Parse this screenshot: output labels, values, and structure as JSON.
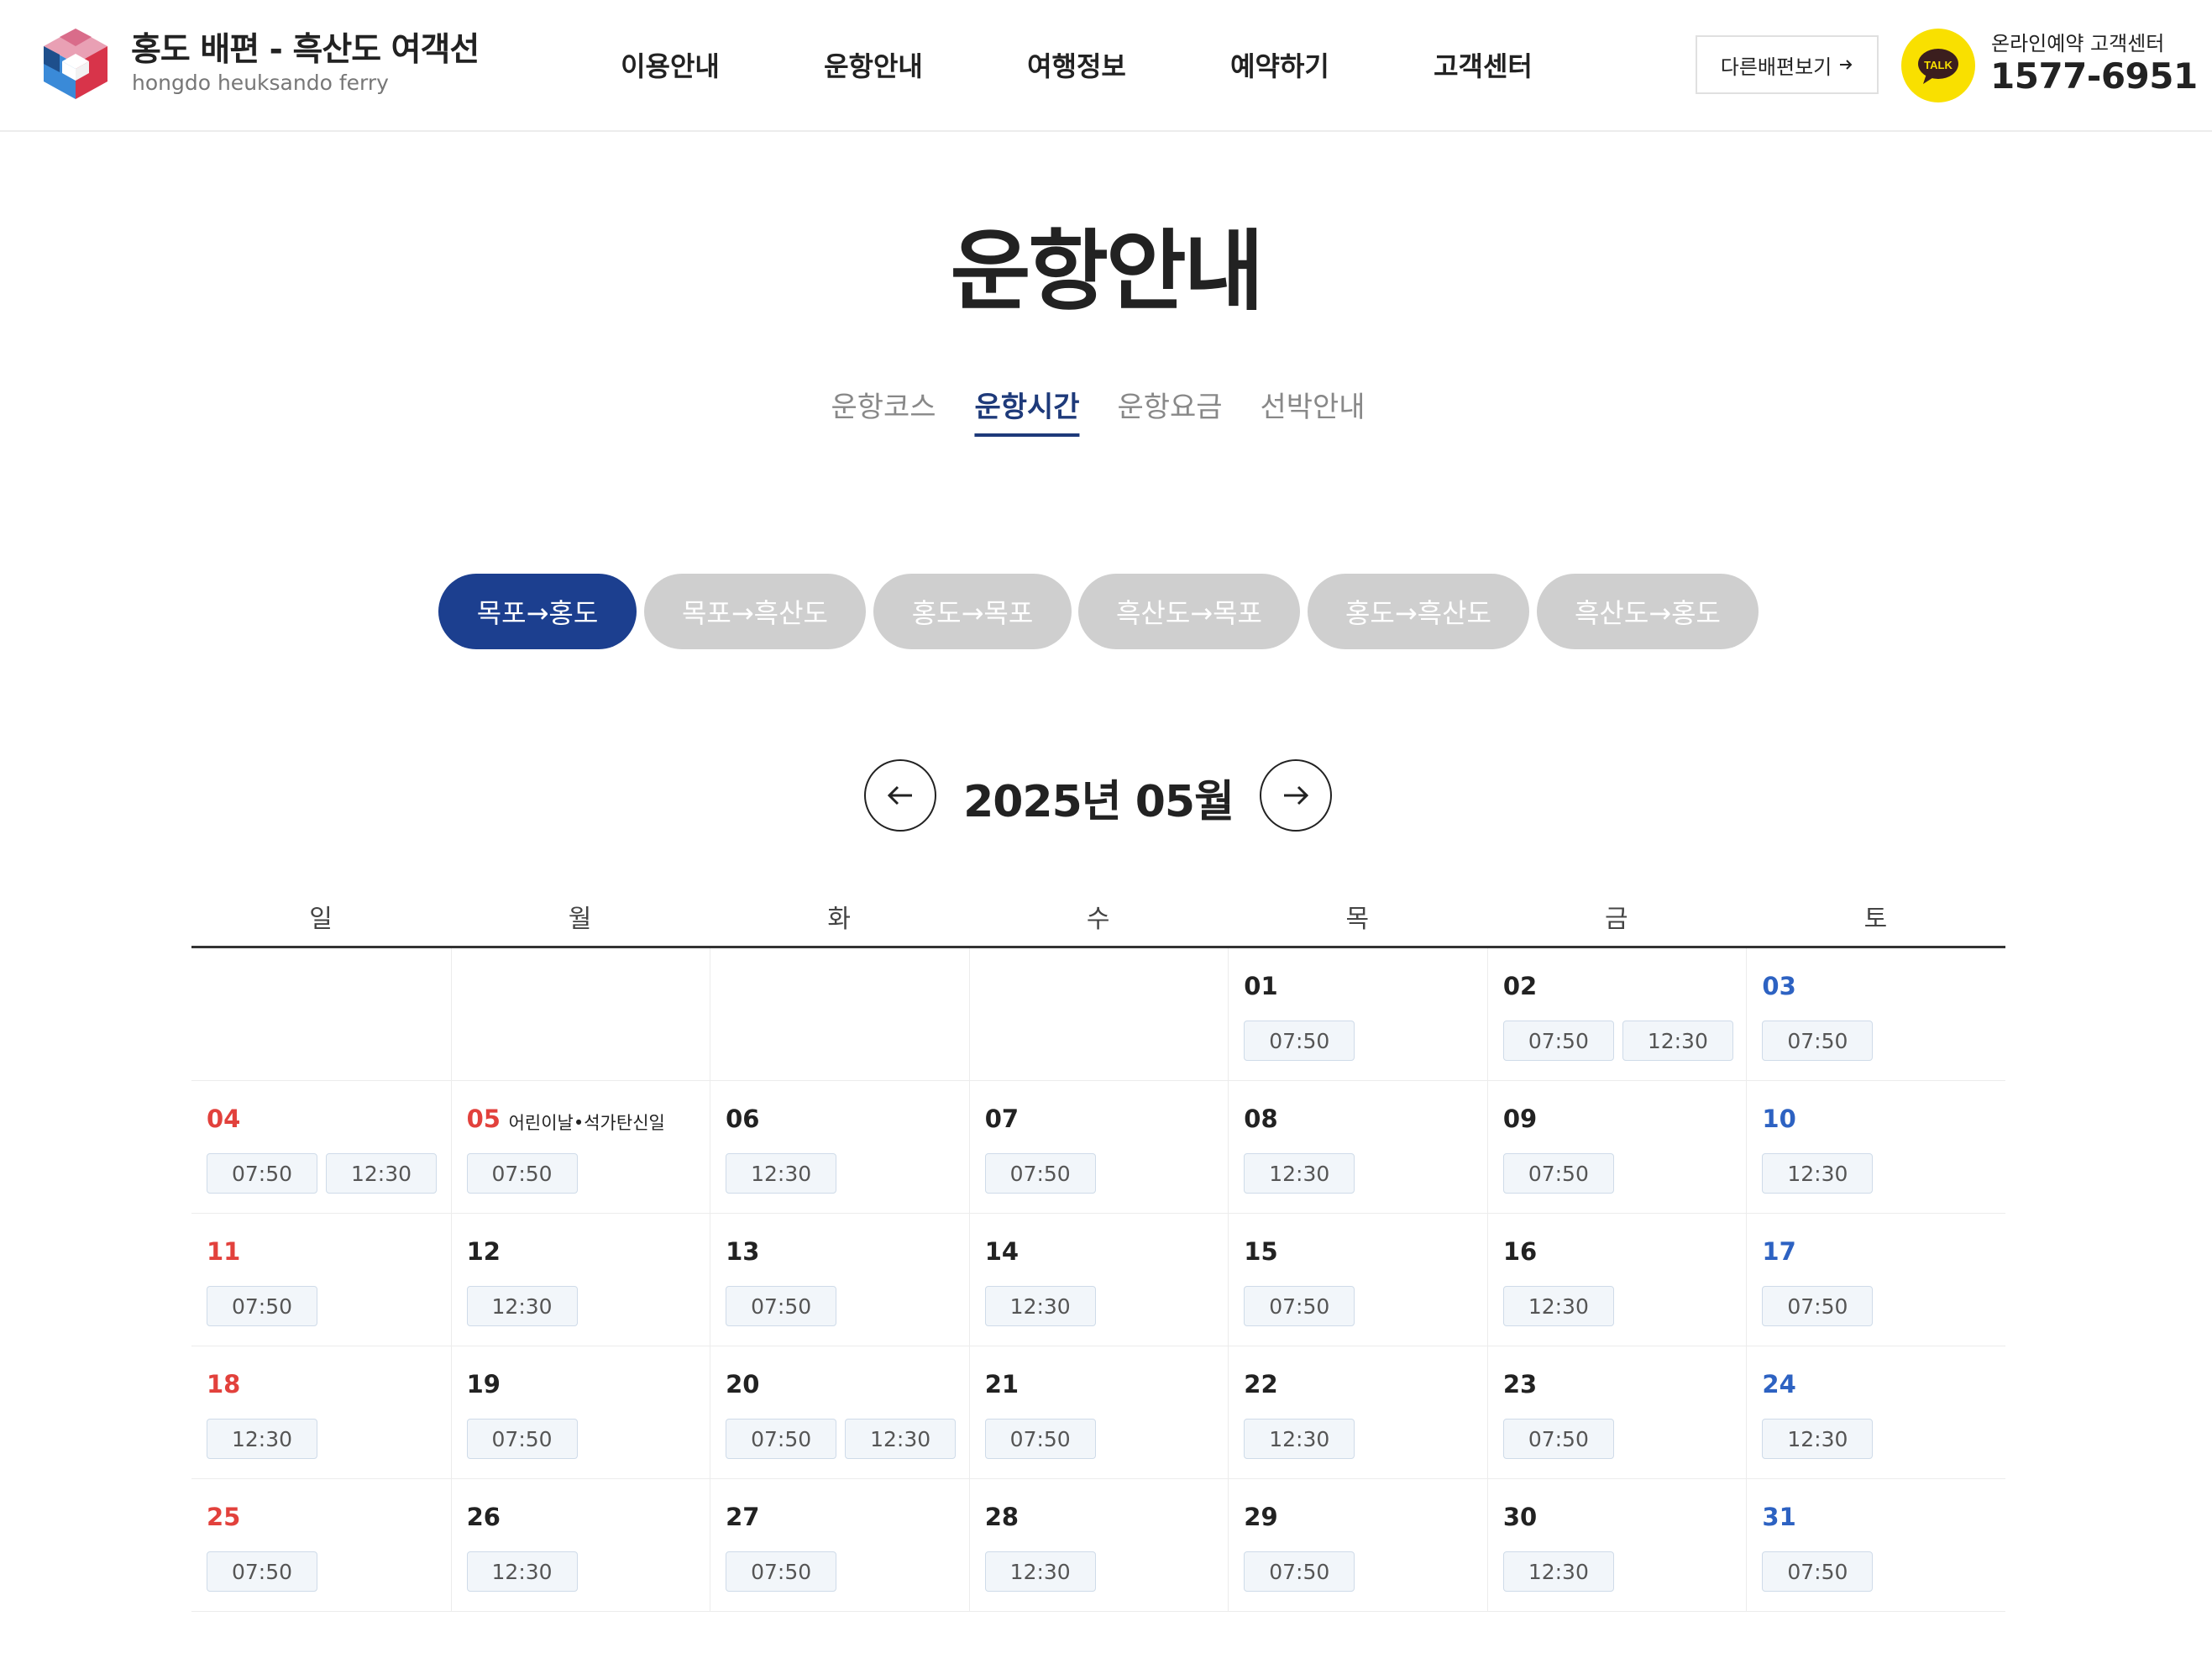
{
  "header": {
    "brand_title": "홍도 배편 - 흑산도 여객선",
    "brand_sub": "hongdo heuksando ferry",
    "nav": [
      "이용안내",
      "운항안내",
      "여행정보",
      "예약하기",
      "고객센터"
    ],
    "other_button": "다른배편보기",
    "talk_icon_text": "TALK",
    "cs_label": "온라인예약 고객센터",
    "cs_phone": "1577-6951"
  },
  "page_title": "운항안내",
  "subtabs": [
    {
      "label": "운항코스",
      "active": false
    },
    {
      "label": "운항시간",
      "active": true
    },
    {
      "label": "운항요금",
      "active": false
    },
    {
      "label": "선박안내",
      "active": false
    }
  ],
  "routes": [
    {
      "label": "목포→홍도",
      "active": true
    },
    {
      "label": "목포→흑산도",
      "active": false
    },
    {
      "label": "홍도→목포",
      "active": false
    },
    {
      "label": "흑산도→목포",
      "active": false
    },
    {
      "label": "홍도→흑산도",
      "active": false
    },
    {
      "label": "흑산도→홍도",
      "active": false
    }
  ],
  "calendar": {
    "month_label": "2025년 05월",
    "weekdays": [
      "일",
      "월",
      "화",
      "수",
      "목",
      "금",
      "토"
    ],
    "weeks": [
      [
        null,
        null,
        null,
        null,
        {
          "day": "01",
          "times": [
            "07:50"
          ]
        },
        {
          "day": "02",
          "times": [
            "07:50",
            "12:30"
          ]
        },
        {
          "day": "03",
          "times": [
            "07:50"
          ]
        }
      ],
      [
        {
          "day": "04",
          "times": [
            "07:50",
            "12:30"
          ]
        },
        {
          "day": "05",
          "holiday": "어린이날•석가탄신일",
          "times": [
            "07:50"
          ]
        },
        {
          "day": "06",
          "times": [
            "12:30"
          ]
        },
        {
          "day": "07",
          "times": [
            "07:50"
          ]
        },
        {
          "day": "08",
          "times": [
            "12:30"
          ]
        },
        {
          "day": "09",
          "times": [
            "07:50"
          ]
        },
        {
          "day": "10",
          "times": [
            "12:30"
          ]
        }
      ],
      [
        {
          "day": "11",
          "times": [
            "07:50"
          ]
        },
        {
          "day": "12",
          "times": [
            "12:30"
          ]
        },
        {
          "day": "13",
          "times": [
            "07:50"
          ]
        },
        {
          "day": "14",
          "times": [
            "12:30"
          ]
        },
        {
          "day": "15",
          "times": [
            "07:50"
          ]
        },
        {
          "day": "16",
          "times": [
            "12:30"
          ]
        },
        {
          "day": "17",
          "times": [
            "07:50"
          ]
        }
      ],
      [
        {
          "day": "18",
          "times": [
            "12:30"
          ]
        },
        {
          "day": "19",
          "times": [
            "07:50"
          ]
        },
        {
          "day": "20",
          "times": [
            "07:50",
            "12:30"
          ]
        },
        {
          "day": "21",
          "times": [
            "07:50"
          ]
        },
        {
          "day": "22",
          "times": [
            "12:30"
          ]
        },
        {
          "day": "23",
          "times": [
            "07:50"
          ]
        },
        {
          "day": "24",
          "times": [
            "12:30"
          ]
        }
      ],
      [
        {
          "day": "25",
          "times": [
            "07:50"
          ]
        },
        {
          "day": "26",
          "times": [
            "12:30"
          ]
        },
        {
          "day": "27",
          "times": [
            "07:50"
          ]
        },
        {
          "day": "28",
          "times": [
            "12:30"
          ]
        },
        {
          "day": "29",
          "times": [
            "07:50"
          ]
        },
        {
          "day": "30",
          "times": [
            "12:30"
          ]
        },
        {
          "day": "31",
          "times": [
            "07:50"
          ]
        }
      ]
    ]
  },
  "colors": {
    "primary": "#1c3f8f",
    "subtab_active": "#1e3a7a",
    "sunday": "#e2413c",
    "saturday": "#2d62c2",
    "pill_inactive": "#cfcfcf",
    "kakao": "#f9e000"
  },
  "icons": {
    "logo": "hexagon-cube-logo",
    "talk": "kakao-talk-icon",
    "prev": "arrow-left-icon",
    "next": "arrow-right-icon",
    "other": "arrow-right-icon"
  }
}
